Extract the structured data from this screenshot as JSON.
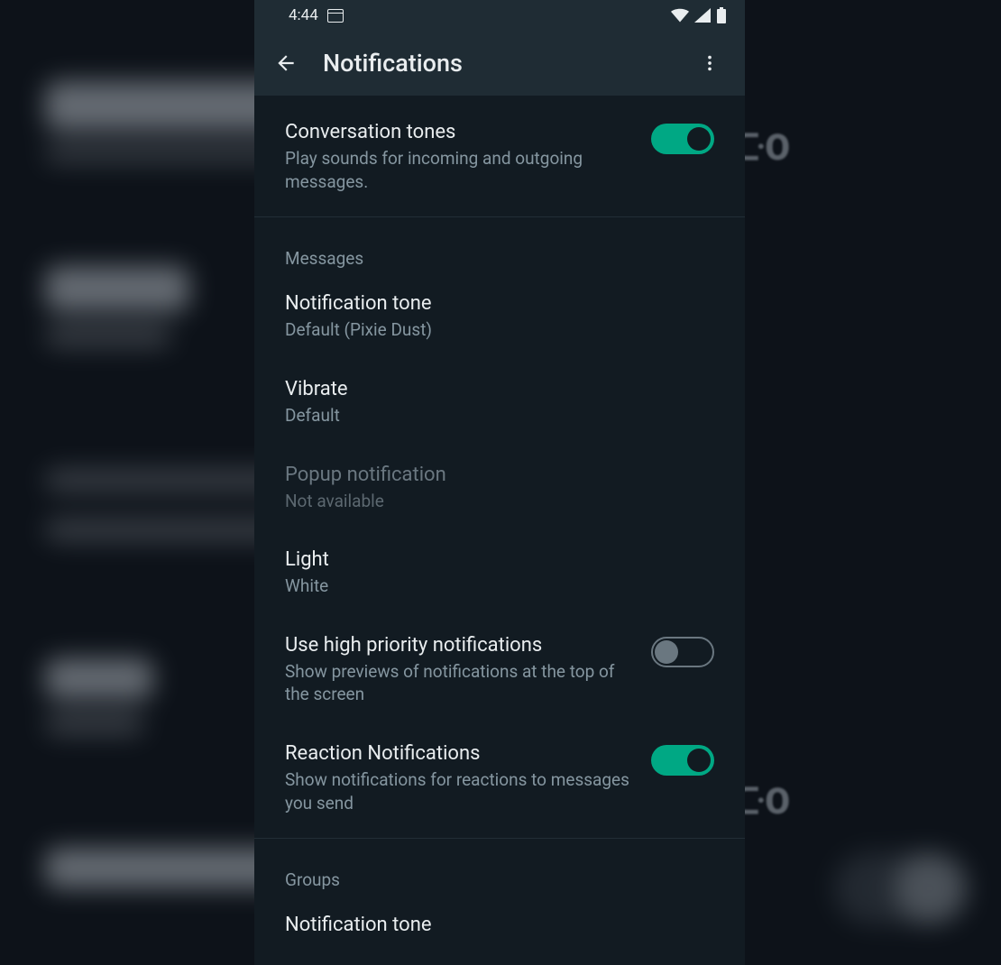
{
  "statusbar": {
    "time": "4:44"
  },
  "appbar": {
    "title": "Notifications"
  },
  "conversation_tones": {
    "title": "Conversation tones",
    "subtitle": "Play sounds for incoming and outgoing messages.",
    "enabled": true
  },
  "sections": {
    "messages": {
      "header": "Messages",
      "notification_tone": {
        "title": "Notification tone",
        "value": "Default (Pixie Dust)"
      },
      "vibrate": {
        "title": "Vibrate",
        "value": "Default"
      },
      "popup": {
        "title": "Popup notification",
        "value": "Not available"
      },
      "light": {
        "title": "Light",
        "value": "White"
      },
      "high_priority": {
        "title": "Use high priority notifications",
        "subtitle": "Show previews of notifications at the top of the screen",
        "enabled": false
      },
      "reaction": {
        "title": "Reaction Notifications",
        "subtitle": "Show notifications for reactions to messages you send",
        "enabled": true
      }
    },
    "groups": {
      "header": "Groups",
      "notification_tone": {
        "title": "Notification tone"
      }
    }
  }
}
